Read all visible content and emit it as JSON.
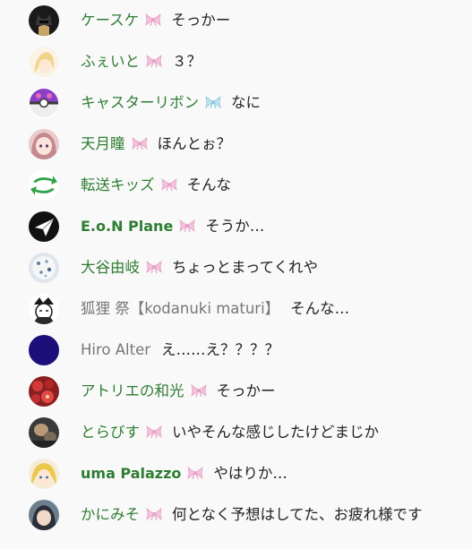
{
  "colors": {
    "member_name": "#2e7d32",
    "plain_name": "#777777",
    "message_text": "#222222",
    "background": "#f9f9f9"
  },
  "chat": {
    "messages": [
      {
        "author": "ケースケ",
        "author_style": "member",
        "badge": "pink-ribbon-icon",
        "text": "そっかー",
        "avatar": "batman-avatar"
      },
      {
        "author": "ふぇいと",
        "author_style": "member",
        "badge": "pink-ribbon-icon",
        "text": "３？",
        "avatar": "blonde-anime-avatar"
      },
      {
        "author": "キャスターリボン",
        "author_style": "member",
        "badge": "blue-ribbon-icon",
        "text": "なに",
        "avatar": "purple-sphere-avatar"
      },
      {
        "author": "天月瞳",
        "author_style": "member",
        "badge": "pink-ribbon-icon",
        "text": "ほんとぉ？",
        "avatar": "pink-hair-anime-avatar"
      },
      {
        "author": "転送キッズ",
        "author_style": "member",
        "badge": "pink-ribbon-icon",
        "text": "そんな",
        "avatar": "green-arrows-avatar"
      },
      {
        "author": "E.o.N Plane",
        "author_style": "member-bold",
        "badge": "pink-ribbon-icon",
        "text": "そうか…",
        "avatar": "paper-plane-avatar"
      },
      {
        "author": "大谷由岐",
        "author_style": "member",
        "badge": "pink-ribbon-icon",
        "text": "ちょっとまってくれや",
        "avatar": "dotted-white-avatar"
      },
      {
        "author": "狐狸 祭【kodanuki maturi】",
        "author_style": "plain",
        "badge": "",
        "text": "そんな…",
        "avatar": "sketch-character-avatar"
      },
      {
        "author": "Hiro Alter",
        "author_style": "plain",
        "badge": "",
        "text": "え……え？？？？",
        "avatar": "navy-circle-avatar"
      },
      {
        "author": "アトリエの和光",
        "author_style": "member",
        "badge": "pink-ribbon-icon",
        "text": "そっかー",
        "avatar": "red-flowers-avatar"
      },
      {
        "author": "とらびす",
        "author_style": "member",
        "badge": "pink-ribbon-icon",
        "text": "いやそんな感じしたけどまじか",
        "avatar": "dark-photo-avatar"
      },
      {
        "author": "uma Palazzo",
        "author_style": "member-bold",
        "badge": "pink-ribbon-icon",
        "text": "やはりか…",
        "avatar": "yellow-anime-avatar"
      },
      {
        "author": "かにみそ",
        "author_style": "member",
        "badge": "pink-ribbon-icon",
        "text": "何となく予想はしてた、お疲れ様です",
        "avatar": "dark-hair-avatar"
      }
    ]
  }
}
